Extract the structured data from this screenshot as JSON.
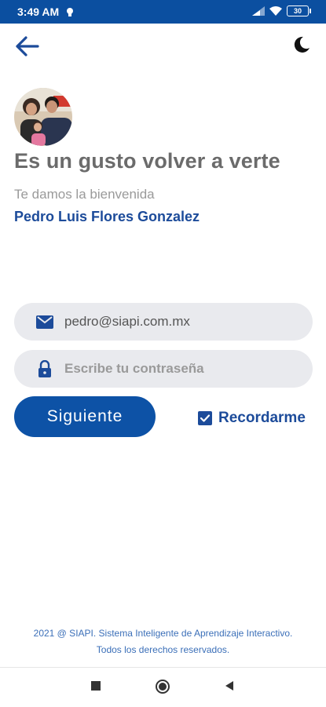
{
  "status_bar": {
    "time": "3:49 AM",
    "battery": "30",
    "icons": [
      "notification-icon",
      "signal-icon",
      "wifi-icon",
      "battery-icon"
    ]
  },
  "header": {
    "back_icon": "arrow-left-icon",
    "theme_icon": "moon-icon"
  },
  "welcome": {
    "title": "Es un gusto volver a verte",
    "subtitle": "Te damos la bienvenida",
    "user_name": "Pedro Luis Flores Gonzalez"
  },
  "form": {
    "email_value": "pedro@siapi.com.mx",
    "password_placeholder": "Escribe tu contraseña",
    "next_label": "Siguiente",
    "remember_label": "Recordarme",
    "remember_checked": true
  },
  "footer": {
    "line1": "2021 @ SIAPI. Sistema Inteligente de Aprendizaje Interactivo.",
    "line2": "Todos los derechos reservados."
  },
  "nav": {
    "icons": [
      "recents-square-icon",
      "home-circle-icon",
      "back-triangle-icon"
    ]
  },
  "colors": {
    "primary": "#0d52a6",
    "status_bar": "#0b4fa0",
    "title_gray": "#6b6b6b",
    "field_bg": "#e9eaee"
  }
}
